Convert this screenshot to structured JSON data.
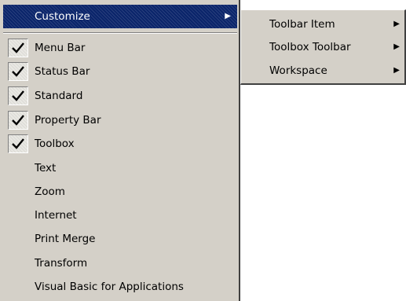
{
  "menu": {
    "header": {
      "label": "Customize"
    },
    "items": [
      {
        "label": "Menu Bar",
        "checked": true
      },
      {
        "label": "Status Bar",
        "checked": true
      },
      {
        "label": "Standard",
        "checked": true
      },
      {
        "label": "Property Bar",
        "checked": true
      },
      {
        "label": "Toolbox",
        "checked": true
      },
      {
        "label": "Text",
        "checked": false
      },
      {
        "label": "Zoom",
        "checked": false
      },
      {
        "label": "Internet",
        "checked": false
      },
      {
        "label": "Print Merge",
        "checked": false
      },
      {
        "label": "Transform",
        "checked": false
      },
      {
        "label": "Visual Basic for Applications",
        "checked": false
      }
    ]
  },
  "submenu": {
    "items": [
      {
        "label": "Toolbar Item"
      },
      {
        "label": "Toolbox Toolbar"
      },
      {
        "label": "Workspace"
      }
    ]
  },
  "icons": {
    "submenu_arrow": "submenu-arrow-icon",
    "check": "checkmark-icon"
  },
  "colors": {
    "menu_background": "#d4d0c8",
    "highlight": "#0a246a",
    "highlight_text": "#ffffff"
  }
}
